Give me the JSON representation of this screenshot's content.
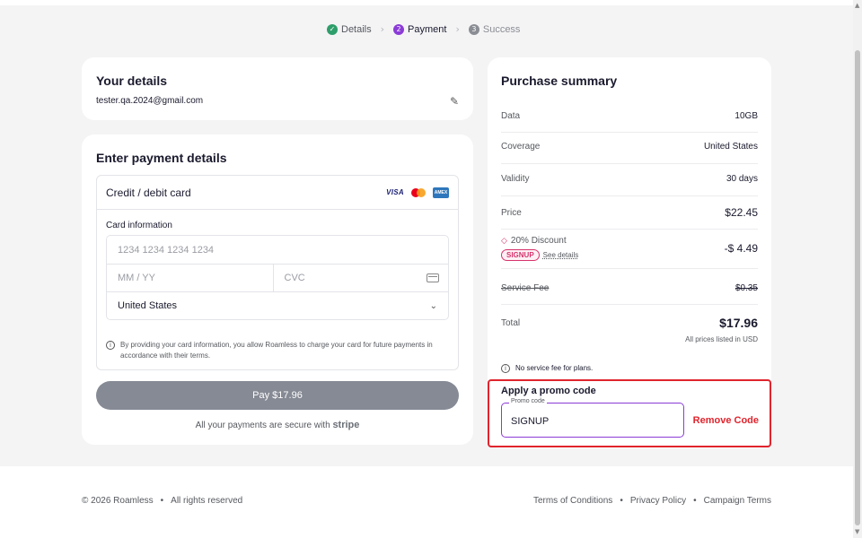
{
  "stepper": {
    "steps": [
      {
        "num": "✓",
        "label": "Details",
        "state": "done"
      },
      {
        "num": "2",
        "label": "Payment",
        "state": "active"
      },
      {
        "num": "3",
        "label": "Success",
        "state": "pending"
      }
    ]
  },
  "details": {
    "title": "Your details",
    "email": "tester.qa.2024@gmail.com",
    "edit_icon": "pencil-icon"
  },
  "payment": {
    "title": "Enter payment details",
    "method_label": "Credit / debit card",
    "brands": [
      "VISA",
      "mastercard",
      "AMEX"
    ],
    "card_info_label": "Card information",
    "card_number_placeholder": "1234 1234 1234 1234",
    "expiry_placeholder": "MM / YY",
    "cvc_placeholder": "CVC",
    "country": "United States",
    "notice": "By providing your card information, you allow Roamless to charge your card for future payments in accordance with their terms.",
    "pay_button": "Pay $17.96",
    "secure_text": "All your payments are secure with",
    "secure_brand": "stripe"
  },
  "summary": {
    "title": "Purchase summary",
    "rows": {
      "data": {
        "k": "Data",
        "v": "10GB"
      },
      "coverage": {
        "k": "Coverage",
        "v": "United States"
      },
      "validity": {
        "k": "Validity",
        "v": "30 days"
      },
      "price": {
        "k": "Price",
        "v": "$22.45"
      },
      "discount": {
        "k": "20% Discount",
        "v": "-$ 4.49",
        "badge": "SIGNUP",
        "link": "See details"
      },
      "service_fee": {
        "k": "Service Fee",
        "v": "$0.35"
      },
      "total": {
        "k": "Total",
        "v": "$17.96"
      }
    },
    "usd_note": "All prices listed in USD",
    "no_fee": "No service fee for plans."
  },
  "promo": {
    "title": "Apply a promo code",
    "field_label": "Promo code",
    "value": "SIGNUP",
    "remove": "Remove Code"
  },
  "footer": {
    "copyright": "© 2026 Roamless",
    "rights": "All rights reserved",
    "links": [
      "Terms of Conditions",
      "Privacy Policy",
      "Campaign Terms"
    ]
  },
  "colors": {
    "accent": "#8b3bd6",
    "success": "#2e9e6a",
    "danger": "#e0242d",
    "pay_button": "#858a94"
  }
}
